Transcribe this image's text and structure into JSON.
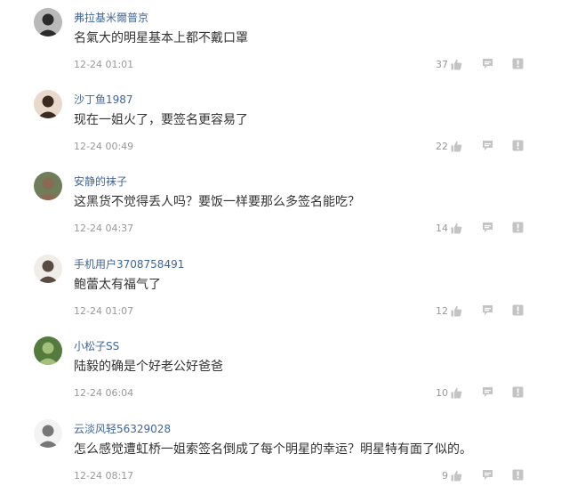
{
  "comments": [
    {
      "username": "弗拉基米爾普京",
      "content": "名氣大的明星基本上都不戴口罩",
      "time": "12-24 01:01",
      "likes": "37",
      "avatar": {
        "bg": "#b9b9b9",
        "fg": "#2b2b2b"
      }
    },
    {
      "username": "沙丁鱼1987",
      "content": "现在一姐火了，要签名更容易了",
      "time": "12-24 00:49",
      "likes": "22",
      "avatar": {
        "bg": "#e9d9cc",
        "fg": "#3a2a22"
      }
    },
    {
      "username": "安静的袜子",
      "content": "这黑货不觉得丢人吗？要饭一样要那么多签名能吃？",
      "time": "12-24 04:37",
      "likes": "14",
      "avatar": {
        "bg": "#6f7d5a",
        "fg": "#8a6a55"
      }
    },
    {
      "username": "手机用户3708758491",
      "content": "鲍蕾太有福气了",
      "time": "12-24 01:07",
      "likes": "12",
      "avatar": {
        "bg": "#f0ece8",
        "fg": "#5a4a44"
      }
    },
    {
      "username": "小松子SS",
      "content": "陆毅的确是个好老公好爸爸",
      "time": "12-24 06:04",
      "likes": "10",
      "avatar": {
        "bg": "#557a3e",
        "fg": "#a2c07a"
      }
    },
    {
      "username": "云淡风轻56329028",
      "content": "怎么感觉遭虹桥一姐索签名倒成了每个明星的幸运？明星特有面了似的。",
      "time": "12-24 08:17",
      "likes": "9",
      "avatar": {
        "bg": "#f3f3f3",
        "fg": "#777777"
      }
    }
  ],
  "icons": {
    "like": "thumbs-up-icon",
    "reply": "comment-bubble-icon",
    "report": "report-icon"
  },
  "colors": {
    "username": "#406599",
    "content": "#333333",
    "meta": "#999999",
    "icon": "#c4c4c4"
  }
}
